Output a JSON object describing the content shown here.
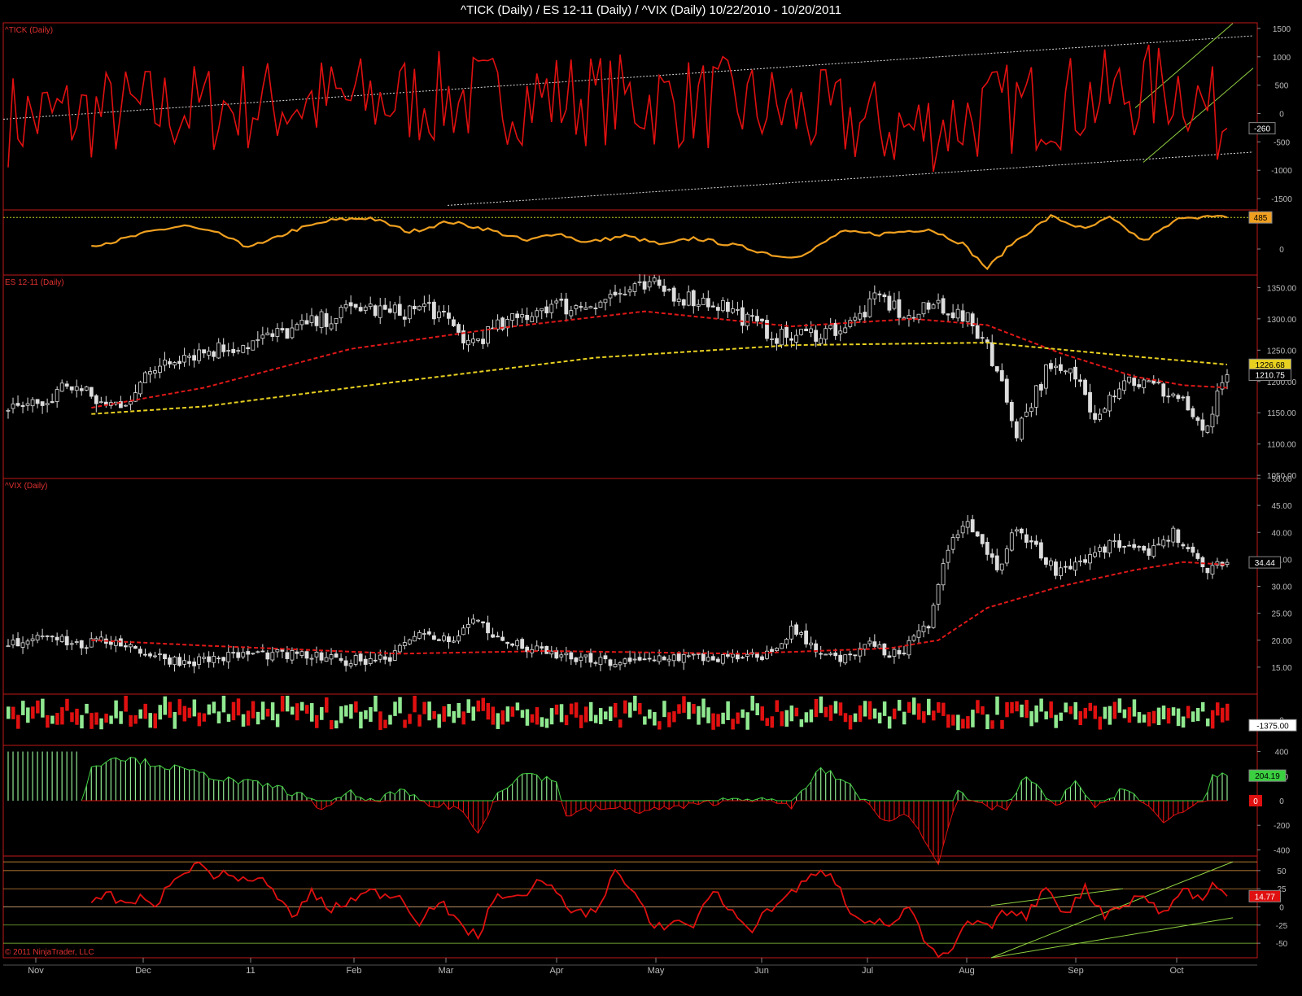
{
  "title": "^TICK (Daily) / ES 12-11 (Daily) / ^VIX (Daily)  10/22/2010 - 10/20/2011",
  "copyright": "© 2011 NinjaTrader, LLC",
  "colors": {
    "border": "#c01818",
    "bullish": "#90e890",
    "bearish": "#e01010",
    "tick": "#e01010",
    "osc": "#f0a020",
    "sma50": "#e01818",
    "sma200": "#e8d020",
    "trend": "#90d040"
  },
  "x_labels": [
    "Nov",
    "Dec",
    "11",
    "Feb",
    "Mar",
    "Apr",
    "May",
    "Jun",
    "Jul",
    "Aug",
    "Sep",
    "Oct"
  ],
  "chart_data": [
    {
      "type": "line",
      "name": "tick",
      "title": "^TICK (Daily)",
      "ylim": [
        -1700,
        1600
      ],
      "yticks": [
        "1500",
        "1000",
        "500",
        "0",
        "-500",
        "-1000",
        "-1500"
      ],
      "last_value": "-260"
    },
    {
      "type": "line",
      "name": "tick-oscillator",
      "ylim": [
        -400,
        600
      ],
      "last_value": "485",
      "yticks": [
        "0"
      ]
    },
    {
      "type": "candlestick",
      "name": "es",
      "title": "ES 12-11 (Daily)",
      "ylim": [
        1045,
        1370
      ],
      "yticks": [
        "1350.00",
        "1300.00",
        "1250.00",
        "1200.00",
        "1150.00",
        "1100.00",
        "1050.00"
      ],
      "last_value": "1210.75",
      "sma200_value": "1226.68"
    },
    {
      "type": "candlestick",
      "name": "vix",
      "title": "^VIX (Daily)",
      "ylim": [
        10,
        50
      ],
      "yticks": [
        "50.00",
        "45.00",
        "40.00",
        "35.00",
        "30.00",
        "25.00",
        "20.00",
        "15.00"
      ],
      "last_value": "34.44"
    },
    {
      "type": "bar",
      "name": "volume-diff",
      "ylim": [
        -700,
        700
      ],
      "yticks": [
        "0"
      ],
      "last_value": "-1375.00"
    },
    {
      "type": "bar",
      "name": "cumulative-histogram",
      "ylim": [
        -450,
        450
      ],
      "yticks": [
        "400",
        "200",
        "0",
        "-200",
        "-400"
      ],
      "last_value": "204.19",
      "zero_badge": "0"
    },
    {
      "type": "line",
      "name": "rsi-oscillator",
      "ylim": [
        -70,
        70
      ],
      "yticks": [
        "50",
        "25",
        "0",
        "-25",
        "-50"
      ],
      "last_value": "14.77"
    }
  ]
}
